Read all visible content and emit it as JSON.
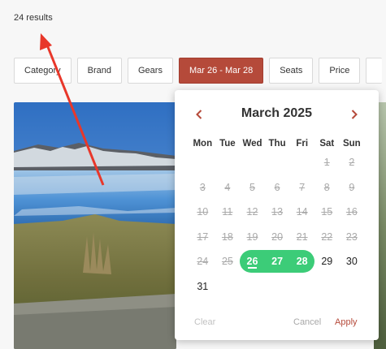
{
  "results": {
    "count_text": "24 results"
  },
  "filters": [
    {
      "label": "Category",
      "active": false
    },
    {
      "label": "Brand",
      "active": false
    },
    {
      "label": "Gears",
      "active": false
    },
    {
      "label": "Mar 26 - Mar 28",
      "active": true
    },
    {
      "label": "Seats",
      "active": false
    },
    {
      "label": "Price",
      "active": false
    }
  ],
  "calendar": {
    "title": "March 2025",
    "weekdays": [
      "Mon",
      "Tue",
      "Wed",
      "Thu",
      "Fri",
      "Sat",
      "Sun"
    ],
    "weeks": [
      [
        {
          "d": ""
        },
        {
          "d": ""
        },
        {
          "d": ""
        },
        {
          "d": ""
        },
        {
          "d": ""
        },
        {
          "d": "1",
          "s": "past"
        },
        {
          "d": "2",
          "s": "past"
        }
      ],
      [
        {
          "d": "3",
          "s": "past"
        },
        {
          "d": "4",
          "s": "past"
        },
        {
          "d": "5",
          "s": "past"
        },
        {
          "d": "6",
          "s": "past"
        },
        {
          "d": "7",
          "s": "past"
        },
        {
          "d": "8",
          "s": "past"
        },
        {
          "d": "9",
          "s": "past"
        }
      ],
      [
        {
          "d": "10",
          "s": "past"
        },
        {
          "d": "11",
          "s": "past"
        },
        {
          "d": "12",
          "s": "past"
        },
        {
          "d": "13",
          "s": "past"
        },
        {
          "d": "14",
          "s": "past"
        },
        {
          "d": "15",
          "s": "past"
        },
        {
          "d": "16",
          "s": "past"
        }
      ],
      [
        {
          "d": "17",
          "s": "past"
        },
        {
          "d": "18",
          "s": "past"
        },
        {
          "d": "19",
          "s": "past"
        },
        {
          "d": "20",
          "s": "past"
        },
        {
          "d": "21",
          "s": "past"
        },
        {
          "d": "22",
          "s": "past"
        },
        {
          "d": "23",
          "s": "past"
        }
      ],
      [
        {
          "d": "24",
          "s": "past"
        },
        {
          "d": "25",
          "s": "past"
        },
        {
          "d": "26",
          "s": "sel-start"
        },
        {
          "d": "27",
          "s": "sel"
        },
        {
          "d": "28",
          "s": "sel-end"
        },
        {
          "d": "29",
          "s": "avail"
        },
        {
          "d": "30",
          "s": "avail"
        }
      ],
      [
        {
          "d": "31",
          "s": "avail"
        },
        {
          "d": ""
        },
        {
          "d": ""
        },
        {
          "d": ""
        },
        {
          "d": ""
        },
        {
          "d": ""
        },
        {
          "d": ""
        }
      ]
    ],
    "today": "26",
    "clear_label": "Clear",
    "cancel_label": "Cancel",
    "apply_label": "Apply",
    "selection_color": "#3ccc78",
    "accent_color": "#b54a3a"
  },
  "icons": {
    "prev": "chevron-left-icon",
    "next": "chevron-right-icon"
  },
  "annotation": {
    "color": "#e8372a",
    "shape": "arrow"
  }
}
